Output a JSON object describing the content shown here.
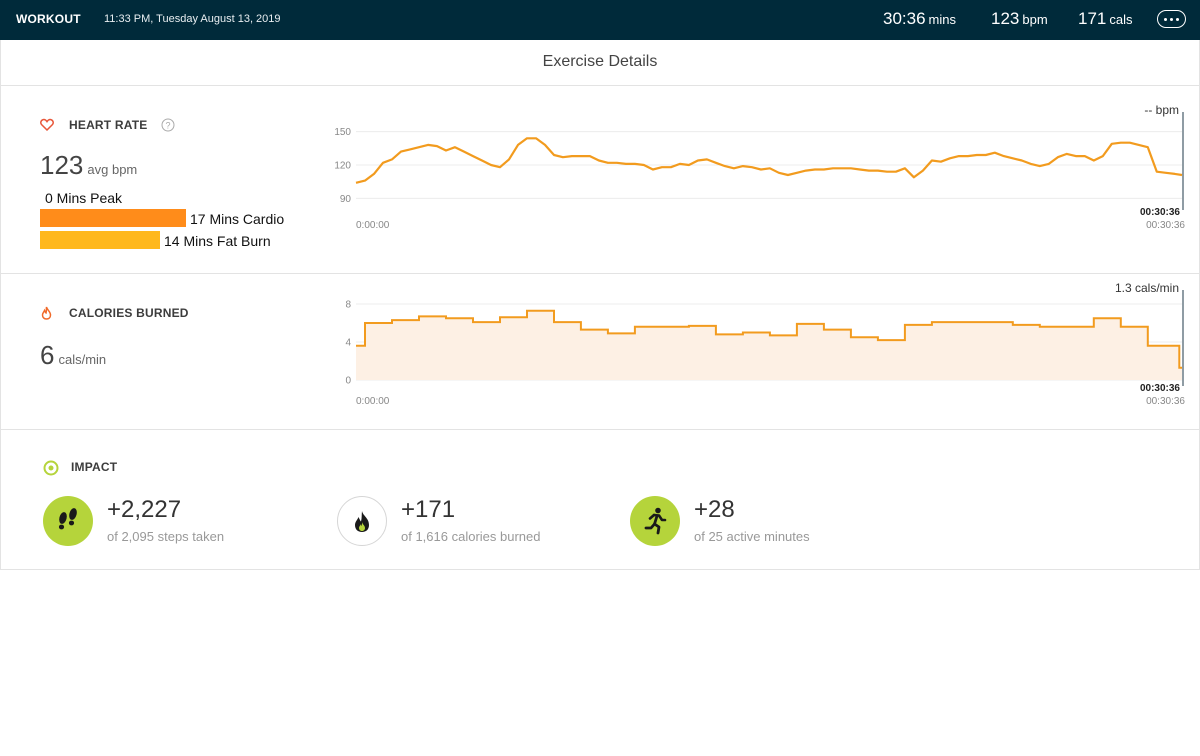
{
  "header": {
    "title": "WORKOUT",
    "datetime": "11:33 PM, Tuesday August 13, 2019",
    "duration": {
      "value": "30:36",
      "unit": "mins"
    },
    "heart_rate": {
      "value": "123",
      "unit": "bpm"
    },
    "calories": {
      "value": "171",
      "unit": "cals"
    },
    "more_icon": "ellipsis-icon"
  },
  "page_title": "Exercise Details",
  "heart_rate": {
    "label": "HEART RATE",
    "icon": "heart-icon",
    "help_icon": "help-icon",
    "avg_value": "123",
    "avg_unit": "avg bpm",
    "zones": [
      {
        "label": "0 Mins Peak",
        "minutes": 0,
        "color": "#f06a2a"
      },
      {
        "label": "17 Mins Cardio",
        "minutes": 17,
        "color": "#ff8c1a"
      },
      {
        "label": "14 Mins Fat Burn",
        "minutes": 14,
        "color": "#ffb81c"
      }
    ]
  },
  "calories": {
    "label": "CALORIES BURNED",
    "icon": "flame-icon",
    "value": "6",
    "unit": "cals/min"
  },
  "impact": {
    "label": "IMPACT",
    "icon": "target-icon",
    "items": [
      {
        "icon": "footprints-icon",
        "value": "+2,227",
        "sub": "of 2,095 steps taken",
        "bg": "#b5d43b"
      },
      {
        "icon": "flame-icon",
        "value": "+171",
        "sub": "of 1,616 calories burned",
        "bg": "#ffffff"
      },
      {
        "icon": "runner-icon",
        "value": "+28",
        "sub": "of 25 active minutes",
        "bg": "#b5d43b"
      }
    ]
  },
  "chart_data": [
    {
      "type": "line",
      "series": "heart rate",
      "y_ticks": [
        "150",
        "120",
        "90"
      ],
      "ylim": [
        85,
        155
      ],
      "xlim": [
        0,
        1836
      ],
      "x_start_label": "0:00:00",
      "x_end_label": "00:30:36",
      "cursor_label": "00:30:36",
      "readout": "-- bpm",
      "color": "#f29b1e",
      "grid": true,
      "points": [
        [
          0,
          104
        ],
        [
          20,
          106
        ],
        [
          40,
          112
        ],
        [
          60,
          122
        ],
        [
          80,
          125
        ],
        [
          100,
          132
        ],
        [
          120,
          134
        ],
        [
          140,
          136
        ],
        [
          160,
          138
        ],
        [
          180,
          137
        ],
        [
          200,
          133
        ],
        [
          220,
          136
        ],
        [
          240,
          132
        ],
        [
          260,
          128
        ],
        [
          280,
          124
        ],
        [
          300,
          120
        ],
        [
          320,
          118
        ],
        [
          340,
          125
        ],
        [
          360,
          138
        ],
        [
          380,
          144
        ],
        [
          400,
          144
        ],
        [
          420,
          138
        ],
        [
          440,
          129
        ],
        [
          460,
          127
        ],
        [
          480,
          128
        ],
        [
          500,
          128
        ],
        [
          520,
          128
        ],
        [
          540,
          124
        ],
        [
          560,
          122
        ],
        [
          580,
          122
        ],
        [
          600,
          121
        ],
        [
          620,
          121
        ],
        [
          640,
          120
        ],
        [
          660,
          116
        ],
        [
          680,
          118
        ],
        [
          700,
          118
        ],
        [
          720,
          121
        ],
        [
          740,
          120
        ],
        [
          760,
          124
        ],
        [
          780,
          125
        ],
        [
          800,
          122
        ],
        [
          820,
          119
        ],
        [
          840,
          117
        ],
        [
          860,
          119
        ],
        [
          880,
          118
        ],
        [
          900,
          116
        ],
        [
          920,
          117
        ],
        [
          940,
          113
        ],
        [
          960,
          111
        ],
        [
          980,
          113
        ],
        [
          1000,
          115
        ],
        [
          1020,
          116
        ],
        [
          1040,
          116
        ],
        [
          1060,
          117
        ],
        [
          1080,
          117
        ],
        [
          1100,
          117
        ],
        [
          1120,
          116
        ],
        [
          1140,
          115
        ],
        [
          1160,
          115
        ],
        [
          1180,
          114
        ],
        [
          1200,
          114
        ],
        [
          1220,
          117
        ],
        [
          1240,
          109
        ],
        [
          1260,
          115
        ],
        [
          1280,
          124
        ],
        [
          1300,
          123
        ],
        [
          1320,
          126
        ],
        [
          1340,
          128
        ],
        [
          1360,
          128
        ],
        [
          1380,
          129
        ],
        [
          1400,
          129
        ],
        [
          1420,
          131
        ],
        [
          1440,
          128
        ],
        [
          1460,
          126
        ],
        [
          1480,
          124
        ],
        [
          1500,
          121
        ],
        [
          1520,
          119
        ],
        [
          1540,
          121
        ],
        [
          1560,
          127
        ],
        [
          1580,
          130
        ],
        [
          1600,
          128
        ],
        [
          1620,
          128
        ],
        [
          1640,
          124
        ],
        [
          1660,
          128
        ],
        [
          1680,
          139
        ],
        [
          1700,
          140
        ],
        [
          1720,
          140
        ],
        [
          1740,
          138
        ],
        [
          1760,
          136
        ],
        [
          1780,
          114
        ],
        [
          1800,
          113
        ],
        [
          1820,
          112
        ],
        [
          1836,
          111
        ]
      ]
    },
    {
      "type": "area",
      "series": "calories per minute",
      "y_ticks": [
        "8",
        "4",
        "0"
      ],
      "ylim": [
        0,
        8
      ],
      "xlim": [
        0,
        1836
      ],
      "x_start_label": "0:00:00",
      "x_end_label": "00:30:36",
      "cursor_label": "00:30:36",
      "readout": "1.3 cals/min",
      "color": "#f29b1e",
      "fill": "#fdf0e4",
      "grid": true,
      "steps": [
        [
          0,
          3.6
        ],
        [
          20,
          6.0
        ],
        [
          80,
          6.3
        ],
        [
          140,
          6.7
        ],
        [
          200,
          6.5
        ],
        [
          260,
          6.1
        ],
        [
          320,
          6.6
        ],
        [
          380,
          7.3
        ],
        [
          440,
          6.1
        ],
        [
          500,
          5.3
        ],
        [
          560,
          4.9
        ],
        [
          620,
          5.6
        ],
        [
          740,
          5.7
        ],
        [
          800,
          4.8
        ],
        [
          860,
          5.0
        ],
        [
          920,
          4.7
        ],
        [
          980,
          5.9
        ],
        [
          1040,
          5.3
        ],
        [
          1100,
          4.5
        ],
        [
          1160,
          4.2
        ],
        [
          1220,
          5.8
        ],
        [
          1280,
          6.1
        ],
        [
          1460,
          5.8
        ],
        [
          1520,
          5.6
        ],
        [
          1640,
          6.5
        ],
        [
          1700,
          5.6
        ],
        [
          1760,
          3.6
        ],
        [
          1830,
          1.3
        ]
      ]
    }
  ]
}
